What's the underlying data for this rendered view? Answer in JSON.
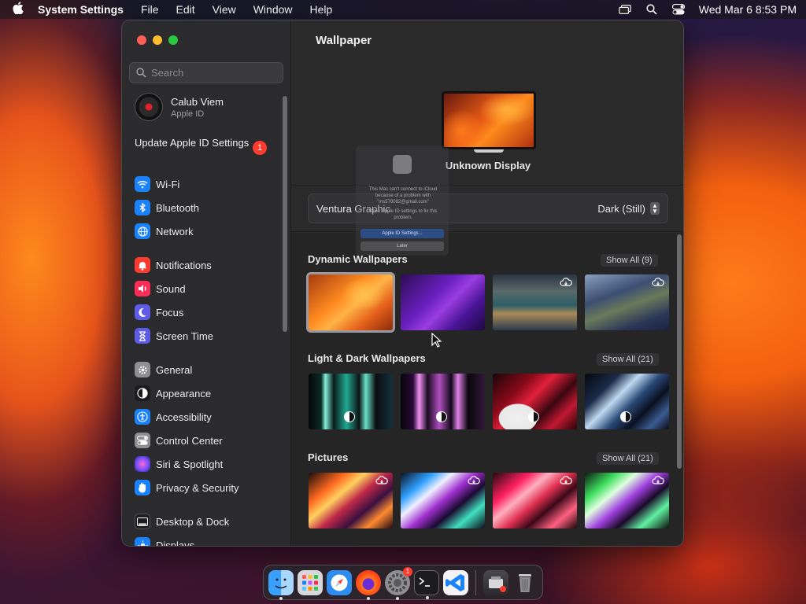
{
  "menubar": {
    "app_name": "System Settings",
    "items": [
      "File",
      "Edit",
      "View",
      "Window",
      "Help"
    ],
    "clock": "Wed Mar 6  8:53 PM"
  },
  "sidebar": {
    "search_placeholder": "Search",
    "profile": {
      "name": "Calub Viem",
      "sub": "Apple ID"
    },
    "update": {
      "label": "Update Apple ID Settings",
      "badge": "1"
    },
    "items": [
      {
        "label": "Wi-Fi",
        "icon": "wifi-icon",
        "color": "#1a82fb"
      },
      {
        "label": "Bluetooth",
        "icon": "bluetooth-icon",
        "color": "#1a82fb"
      },
      {
        "label": "Network",
        "icon": "globe-icon",
        "color": "#1a82fb"
      },
      {
        "label": "Notifications",
        "icon": "bell-icon",
        "color": "#ff3b30"
      },
      {
        "label": "Sound",
        "icon": "speaker-icon",
        "color": "#ff2d55"
      },
      {
        "label": "Focus",
        "icon": "moon-icon",
        "color": "#5e5ce6"
      },
      {
        "label": "Screen Time",
        "icon": "hourglass-icon",
        "color": "#5e5ce6"
      },
      {
        "label": "General",
        "icon": "gear-icon",
        "color": "#8e8e93"
      },
      {
        "label": "Appearance",
        "icon": "appearance-icon",
        "color": "#1c1c1e"
      },
      {
        "label": "Accessibility",
        "icon": "accessibility-icon",
        "color": "#1a82fb"
      },
      {
        "label": "Control Center",
        "icon": "toggles-icon",
        "color": "#8e8e93"
      },
      {
        "label": "Siri & Spotlight",
        "icon": "siri-icon",
        "color": "#bf5af2"
      },
      {
        "label": "Privacy & Security",
        "icon": "hand-icon",
        "color": "#1a82fb"
      },
      {
        "label": "Desktop & Dock",
        "icon": "dock-icon",
        "color": "#1c1c1e"
      },
      {
        "label": "Displays",
        "icon": "sun-icon",
        "color": "#1a82fb"
      }
    ]
  },
  "main": {
    "title": "Wallpaper",
    "display_name": "Unknown Display",
    "selected_wallpaper": "Ventura Graphic",
    "mode": "Dark (Still)",
    "sections": [
      {
        "title": "Dynamic Wallpapers",
        "show_all": "Show All (9)"
      },
      {
        "title": "Light & Dark Wallpapers",
        "show_all": "Show All (21)"
      },
      {
        "title": "Pictures",
        "show_all": "Show All (21)"
      }
    ]
  },
  "dialog": {
    "message": "This Mac can't connect to iCloud because of a problem with \"ms578082@gmail.com\"",
    "hint": "Open Apple ID settings to fix this problem.",
    "primary": "Apple ID Settings...",
    "secondary": "Later"
  },
  "dock": {
    "apps": [
      "finder",
      "launchpad",
      "safari",
      "firefox",
      "system-settings",
      "terminal",
      "vscode"
    ],
    "settings_badge": "1"
  }
}
